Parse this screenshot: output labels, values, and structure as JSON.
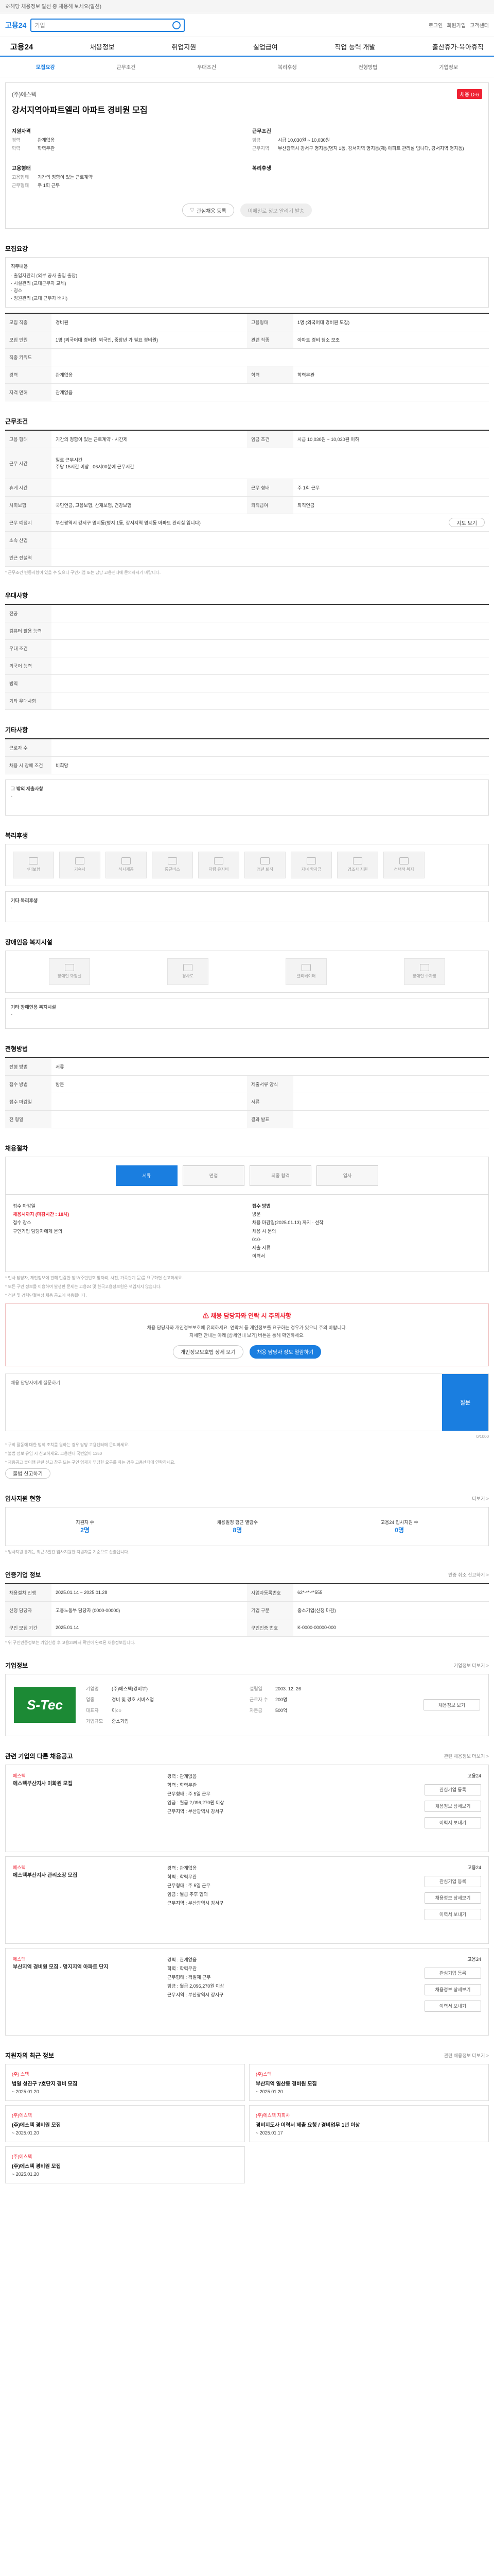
{
  "top": {
    "line1": "※해당 채용정보 알선 중 채용해 보세요(알선)",
    "logo": "고용24",
    "search_placeholder": "기업",
    "util": [
      "로그인",
      "회원가입",
      "고객센터"
    ]
  },
  "gnb": {
    "home": "고용24",
    "items": [
      "채용정보",
      "취업지원",
      "실업급여",
      "직업 능력 개발",
      "출산휴가·육아휴직"
    ]
  },
  "tabs": [
    "모집요강",
    "근무조건",
    "우대조건",
    "복리후생",
    "전형방법",
    "기업정보"
  ],
  "header": {
    "company": "(주)에스텍",
    "badge": "채용 D-6",
    "title": "강서지역아파트엘리 아파트 경비원 모집",
    "col1_title": "지원자격",
    "col1": [
      {
        "k": "경력",
        "v": "관계없음"
      },
      {
        "k": "학력",
        "v": "학력무관"
      }
    ],
    "col1b_title": "고용형태",
    "col1b": [
      {
        "k": "고용형태",
        "v": "기간의 정함이 있는 근로계약"
      },
      {
        "k": "근무형태",
        "v": "주 1회 근무"
      }
    ],
    "col2_title": "근무조건",
    "col2": [
      {
        "k": "임금",
        "v": "시급 10,030원 ~ 10,030원"
      },
      {
        "k": "근무지역",
        "v": "부산광역시 강서구 명지동(명지 1동, 강서지역 명지동(제) 아파트 관리실 입니다, 강서지역 명지동)"
      }
    ],
    "col2b_title": "복리후생",
    "buttons": {
      "save": "관심채용 등록",
      "share": "이메일로 정보 알리기 발송"
    }
  },
  "recruit": {
    "title": "모집요강",
    "box_title": "직무내용",
    "box_lines": [
      "· 출입자관리 (외부 공사 출입 출장)",
      "· 시설관리 (교대근무자 교체)",
      "· 청소",
      "· 정원관리 (교대 근무자 배치)"
    ],
    "rows": [
      {
        "th": "모집 직종",
        "td": "경비원",
        "th2": "고용형태",
        "td2": "1명 (외국어대 경비원 모집)"
      },
      {
        "th": "모집 인원",
        "td": "1명 (외국어대 경비원, 외국인, 중장년 가 필요 경비원)",
        "th2": "관련 직종",
        "td2": "아파트 경비 청소 보조"
      },
      {
        "th": "직종 키워드",
        "td": "",
        "th2": "",
        "td2": ""
      },
      {
        "th": "경력",
        "td": "관계없음",
        "th2": "학력",
        "td2": "학력무관"
      },
      {
        "th": "자격 면허",
        "td": "관계없음",
        "th2": "",
        "td2": ""
      }
    ]
  },
  "conditions": {
    "title": "근무조건",
    "rows": [
      {
        "th": "고용 형태",
        "td": "기간의 정함이 있는 근로계약 · 시간제",
        "th2": "임금 조건",
        "td2": "시급 10,030원 ~ 10,030원 이하"
      },
      {
        "th": "근무 시간",
        "td": "일로 근무시간\n주당 15시간 이상 : 06시00분에 근무시간",
        "th2": "",
        "td2": ""
      },
      {
        "th": "휴게 시간",
        "td": "",
        "th2": "근무 형태",
        "td2": "주 1회 근무"
      },
      {
        "th": "사회보험",
        "td": "국민연금, 고용보험, 산재보험, 건강보험",
        "th2": "퇴직급여",
        "td2": "퇴직연금"
      },
      {
        "th": "근무 예정지",
        "td": "부산광역시 강서구 명지동(명지 1동, 강서지역 명지동 아파트 관리실 입니다)",
        "th2": "",
        "td2": ""
      },
      {
        "th": "소속 산업",
        "td": "",
        "th2": "",
        "td2": ""
      },
      {
        "th": "인근 전철역",
        "td": "",
        "th2": "",
        "td2": ""
      }
    ],
    "note": "* 근무조건 변동사항이 있을 수 있으니 구인기업 또는 담당 고용센터에 문의하시기 바랍니다."
  },
  "pref": {
    "title": "우대사항",
    "rows": [
      {
        "th": "전공",
        "td": ""
      },
      {
        "th": "컴퓨터 활용 능력",
        "td": ""
      },
      {
        "th": "우대 조건",
        "td": ""
      },
      {
        "th": "외국어 능력",
        "td": ""
      },
      {
        "th": "병역",
        "td": ""
      },
      {
        "th": "기타 우대사항",
        "td": ""
      }
    ]
  },
  "etc": {
    "title": "기타사항",
    "rows": [
      {
        "th": "근로자 수",
        "td": ""
      },
      {
        "th": "채용 시 장애 조건",
        "td": "비희망"
      }
    ],
    "box_title": "그 밖의 제출사항",
    "box_text": "-"
  },
  "welfare": {
    "title": "복리후생",
    "tiles": [
      "4대보험",
      "기숙사",
      "식사제공",
      "통근버스",
      "차량 유지비",
      "정년 퇴직 ",
      "자녀 학자금",
      "경조사 지원",
      "선택적 복지",
      "기타"
    ],
    "extra_label": "기타 복리후생",
    "extra_value": "-"
  },
  "disabled": {
    "title": "장애인용 복지시설",
    "tiles": [
      "장애인 화장실",
      "경사로",
      "엘리베이터",
      "장애인 주차장"
    ],
    "extra_label": "기타 장애인용 복지시설",
    "extra_value": "-"
  },
  "method": {
    "title": "전형방법",
    "rows": [
      {
        "th": "전형 방법",
        "td": "서류",
        "th2": "",
        "td2": ""
      },
      {
        "th": "접수 방법",
        "td": "방문",
        "th2": "제출서류 양식",
        "td2": ""
      },
      {
        "th": "접수 마감일",
        "td": "",
        "th2": "서류",
        "td2": ""
      },
      {
        "th": "전 형일",
        "td": "",
        "th2": "결과 발표",
        "td2": ""
      }
    ]
  },
  "apply": {
    "title": "채용절차",
    "steps": [
      "서류",
      "면접",
      "최종 합격",
      "입사"
    ],
    "contact_title": "접수 방법",
    "contact_lines": [
      "방문",
      "채용 마감일(2025.01.13) 까지 · 선착",
      "채용 시 문의",
      "010-",
      "제출 서류",
      "이력서"
    ],
    "left": [
      "접수 마감일",
      "채용시까지 (마감시간 : 18시)",
      "",
      "접수 장소",
      "구인기업 담당자에게 문의",
      ""
    ],
    "notes": [
      "* 인사 담당자, 개인정보에 관해 민감한 정보(주민번호 앞자리, 사진, 가족관계 등)를 요구하면 신고하세요.",
      "* 모든 구인 정보를 이용하여 발생한 문제는 고용24 및 한국고용정보원은 책임지지 않습니다.",
      "* 청년 및 경력단절여성 채용 공고에 적용됩니다."
    ]
  },
  "caution": {
    "title": "채용 담당자와 연락 시 주의사항",
    "text1": "채용 담당자와 개인정보보호에 유의하세요. 연락처 등 개인정보를 요구하는 경우가 있으니 주의 바랍니다.",
    "text2": "자세한 안내는 아래 [상세안내 보기] 버튼을 통해 확인하세요.",
    "btn1": "개인정보보호법 상세 보기",
    "btn2": "채용 담당자 정보 열람하기",
    "placeholder": "채용 담당자에게 질문하기",
    "apply": "질문",
    "counter": "0/1000",
    "warns": [
      "* 구직 활동에 대한 법적 조치를 원하는 경우 담당 고용센터에 문의하세요.",
      "* 불법 정보 유입 시 신고하세요. 고용센터 국번없이 1350",
      "* 채용공고 불이행 관련 신고 창구 또는 구인 업체가 부당한 요구를 하는 경우 고용센터에 연락하세요."
    ],
    "report": "불법 신고하기"
  },
  "recent": {
    "title": "입사지원 현황",
    "more": "더보기 >",
    "items": [
      {
        "label": "지원자 수",
        "value": "2명"
      },
      {
        "label": "채용일정 평균 열람수",
        "value": "8명"
      },
      {
        "label": "고용24 입사지원 수",
        "value": "0명"
      }
    ],
    "note": "* 입사지원 통계는 최근 3일간 입사지원한 지원자를 기준으로 산출됩니다."
  },
  "job_info": {
    "title": "인증기업 정보",
    "more": "인증 취소 신고하기 >",
    "rows": [
      {
        "th": "채용절차 진행",
        "td": "2025.01.14 ~ 2025.01.28",
        "th2": "사업자등록번호",
        "td2": "62*-**-**555"
      },
      {
        "th": "신청 담당자",
        "td": "고용노동부 담당자 (0000-00000)",
        "th2": "기업 구분",
        "td2": "중소기업(신청 마감)"
      },
      {
        "th": "구인 모집 기간",
        "td": "2025.01.14",
        "th2": "구인인증 번호",
        "td2": "K-0000-00000-000"
      }
    ],
    "note": "* 위 구인인증정보는 기업신청 후 고용24에서 확인이 완료된 채용정보입니다."
  },
  "company_info": {
    "title": "기업정보",
    "more": "기업정보 더보기 >",
    "logo": "S-Tec",
    "rows": [
      {
        "k": "기업명",
        "v": "(주)에스텍(경비부)",
        "k2": "설립일",
        "v2": "2003. 12. 26"
      },
      {
        "k": "업종",
        "v": "경비 및 경호 서비스업",
        "k2": "근로자 수",
        "v2": "200명"
      },
      {
        "k": "대표자",
        "v": "이○○",
        "k2": "자본금",
        "v2": "500억"
      },
      {
        "k": "기업규모",
        "v": "중소기업",
        "k2": "",
        "v2": ""
      }
    ],
    "btn": "채용정보 보기"
  },
  "same_company": {
    "title": "관련 기업의 다른 채용공고",
    "more": "관련 채용정보 더보기 >",
    "cards": [
      {
        "company": "에스텍",
        "title": "에스텍부산지사 미화원 모집",
        "lines": [
          "경력 : 관계없음",
          "학력 : 학력무관",
          "근무형태 : 주 5일 근무",
          "임금 : 월급 2,096,270원 이상",
          "근무지역 : 부산광역시 강서구"
        ],
        "right": [
          "고용24",
          "모집직종 : 미화원",
          "등록일 : 2025.01.13"
        ]
      },
      {
        "company": "에스텍",
        "title": "에스텍부산지사 관리소장 모집",
        "lines": [
          "경력 : 관계없음",
          "학력 : 학력무관",
          "근무형태 : 주 5일 근무",
          "임금 : 월급 추후 협의",
          "근무지역 : 부산광역시 강서구"
        ],
        "right": [
          "고용24",
          "모집직종 : 관리소장",
          "등록일 : 2025.01.13"
        ]
      },
      {
        "company": "에스텍",
        "title": "부산지역 경비원 모집 - 명지지역 아파트 단지",
        "lines": [
          "경력 : 관계없음",
          "학력 : 학력무관",
          "근무형태 : 격일제 근무",
          "임금 : 월급 2,096,270원 이상",
          "근무지역 : 부산광역시 강서구"
        ],
        "right": [
          "고용24",
          "모집직종 : 경비원",
          "등록일 : 2025.01.13"
        ]
      }
    ],
    "btns": [
      "관심기업 등록",
      "채용정보 상세보기",
      "이력서 보내기"
    ]
  },
  "others": {
    "title": "지원자의 최근 정보",
    "more": "관련 채용정보 더보기 >",
    "items": [
      {
        "company": "(주) 스텍",
        "title": "범일 성진구 7호단지 경비 모집",
        "meta": "~ 2025.01.20"
      },
      {
        "company": "(주)스텍",
        "title": "부산지역 일산동 경비원 모집",
        "meta": "~ 2025.01.20"
      },
      {
        "company": "(주)에스텍",
        "title": "(주)에스텍 경비원 모집",
        "meta": "~ 2025.01.20"
      },
      {
        "company": "(주)에스텍 자회사",
        "title": "경비지도사 이력서 제출 요청 / 경비업무 1년 이상",
        "meta": "~ 2025.01.17"
      },
      {
        "company": "(주)에스텍",
        "title": "(주)에스텍 경비원 모집",
        "meta": "~ 2025.01.20"
      }
    ]
  }
}
